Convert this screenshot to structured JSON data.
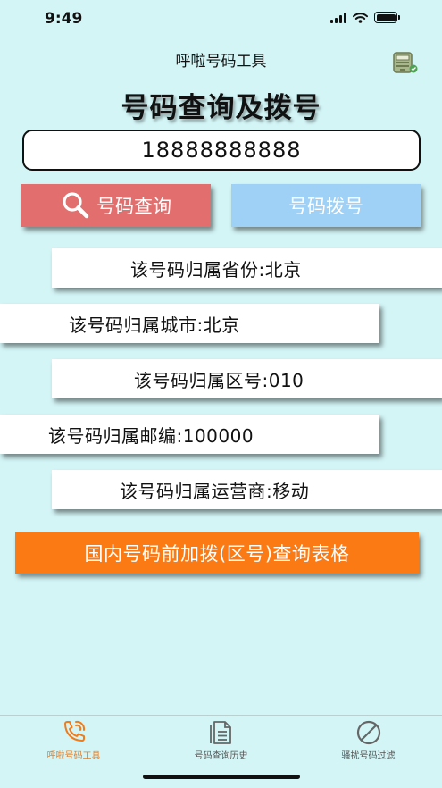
{
  "status": {
    "time": "9:49"
  },
  "nav": {
    "title": "呼啦号码工具",
    "right_icon": "phone-booth-icon"
  },
  "main": {
    "heading": "号码查询及拨号",
    "phone_number": "18888888888",
    "query_button": "号码查询",
    "dial_button": "号码拨号",
    "info": {
      "province": "该号码归属省份:北京",
      "city": "该号码归属城市:北京",
      "area_code": "该号码归属区号:010",
      "postcode": "该号码归属邮编:100000",
      "carrier": "该号码归属运营商:移动"
    },
    "table_button": "国内号码前加拨(区号)查询表格"
  },
  "tabs": [
    {
      "label": "呼啦号码工具",
      "icon": "phone-ringing-icon",
      "active": true
    },
    {
      "label": "号码查询历史",
      "icon": "document-list-icon",
      "active": false
    },
    {
      "label": "骚扰号码过滤",
      "icon": "prohibited-icon",
      "active": false
    }
  ],
  "colors": {
    "background": "#d3f5f6",
    "query_button": "#e26e6e",
    "dial_button": "#9fd1f6",
    "table_button": "#fb7a13",
    "active_tab": "#f07b1c"
  }
}
